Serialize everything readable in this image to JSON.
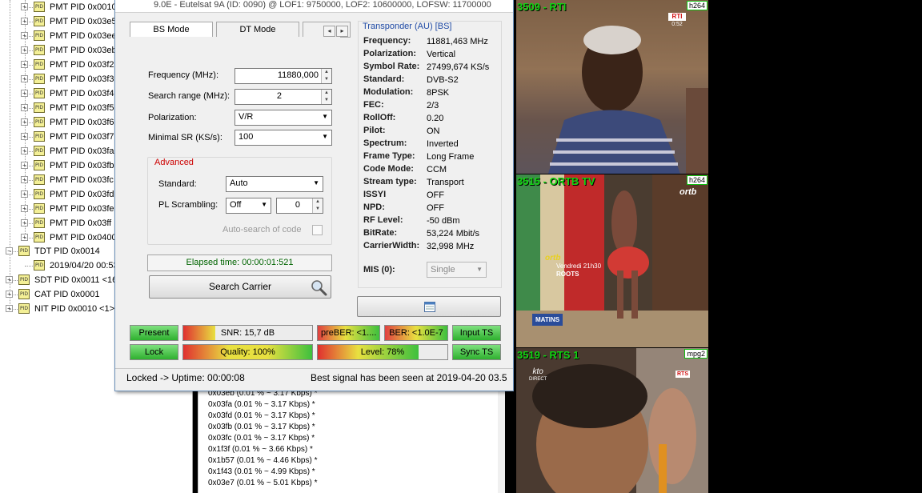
{
  "tree": {
    "pmt_items": [
      "PMT PID 0x0010",
      "PMT PID 0x03e5",
      "PMT PID 0x03ee",
      "PMT PID 0x03eb",
      "PMT PID 0x03f2",
      "PMT PID 0x03f3",
      "PMT PID 0x03f4",
      "PMT PID 0x03f5",
      "PMT PID 0x03f6",
      "PMT PID 0x03f7",
      "PMT PID 0x03fa",
      "PMT PID 0x03fb",
      "PMT PID 0x03fc",
      "PMT PID 0x03fd",
      "PMT PID 0x03fe",
      "PMT PID 0x03ff",
      "PMT PID 0x0400"
    ],
    "tdt": "TDT PID 0x0014",
    "tdt_child": "2019/04/20 00:53",
    "sdt": "SDT PID 0x0011 <16",
    "cat": "CAT PID 0x0001",
    "nit": "NIT PID 0x0010 <1>",
    "icon_tag": "PID"
  },
  "pid_list": [
    "0x03eb (0.01 % ~ 3.17 Kbps) *",
    "0x03fa (0.01 % ~ 3.17 Kbps) *",
    "0x03fd (0.01 % ~ 3.17 Kbps) *",
    "0x03fb (0.01 % ~ 3.17 Kbps) *",
    "0x03fc (0.01 % ~ 3.17 Kbps) *",
    "0x1f3f (0.01 % ~ 3.66 Kbps) *",
    "0x1b57 (0.01 % ~ 4.46 Kbps) *",
    "0x1f43 (0.01 % ~ 4.99 Kbps) *",
    "0x03e7 (0.01 % ~ 5.01 Kbps) *"
  ],
  "dialog": {
    "header": "9.0E - Eutelsat 9A (ID: 0090) @ LOF1: 9750000, LOF2: 10600000, LOFSW: 11700000",
    "tabs": [
      "BS Mode",
      "DT Mode",
      "S"
    ],
    "frequency_label": "Frequency (MHz):",
    "frequency_value": "11880,000",
    "search_range_label": "Search range (MHz):",
    "search_range_value": "2",
    "polarization_label": "Polarization:",
    "polarization_value": "V/R",
    "minimal_sr_label": "Minimal SR (KS/s):",
    "minimal_sr_value": "100",
    "advanced_title": "Advanced",
    "standard_label": "Standard:",
    "standard_value": "Auto",
    "pl_scrambling_label": "PL Scrambling:",
    "pl_scrambling_value": "Off",
    "pl_scrambling_num": "0",
    "auto_search_label": "Auto-search of code",
    "elapsed": "Elapsed time: 00:00:01:521",
    "search_button": "Search Carrier"
  },
  "transponder": {
    "title": "Transponder (AU) [BS]",
    "rows": [
      {
        "k": "Frequency:",
        "v": "11881,463 MHz"
      },
      {
        "k": "Polarization:",
        "v": "Vertical"
      },
      {
        "k": "Symbol Rate:",
        "v": "27499,674 KS/s"
      },
      {
        "k": "Standard:",
        "v": "DVB-S2"
      },
      {
        "k": "Modulation:",
        "v": "8PSK"
      },
      {
        "k": "FEC:",
        "v": "2/3"
      },
      {
        "k": "RollOff:",
        "v": "0.20"
      },
      {
        "k": "Pilot:",
        "v": "ON"
      },
      {
        "k": "Spectrum:",
        "v": "Inverted"
      },
      {
        "k": "Frame Type:",
        "v": "Long Frame"
      },
      {
        "k": "Code Mode:",
        "v": "CCM"
      },
      {
        "k": "Stream type:",
        "v": "Transport"
      },
      {
        "k": "ISSYI",
        "v": "OFF"
      },
      {
        "k": "NPD:",
        "v": "OFF"
      },
      {
        "k": "RF Level:",
        "v": "-50 dBm"
      },
      {
        "k": "BitRate:",
        "v": "53,224 Mbit/s"
      },
      {
        "k": "CarrierWidth:",
        "v": "32,998 MHz"
      }
    ],
    "mis_label": "MIS (0):",
    "mis_value": "Single"
  },
  "status": {
    "present": "Present",
    "lock": "Lock",
    "snr": "SNR: 15,7 dB",
    "snr_fill": 0.25,
    "quality": "Quality: 100%",
    "quality_fill": 1.0,
    "preber": "preBER: <1....",
    "ber": "BER: <1.0E-7",
    "level": "Level: 78%",
    "level_fill": 0.78,
    "input_ts": "Input TS",
    "sync_ts": "Sync TS"
  },
  "statusline": {
    "uptime": "Locked -> Uptime: 00:00:08",
    "best_signal": "Best signal has been seen at 2019-04-20 03.5"
  },
  "videos": [
    {
      "label": "3509 - RTI",
      "codec": "h264",
      "logo": "RTI",
      "logo_sub": "0:52"
    },
    {
      "label": "3515 - ORTB TV",
      "codec": "h264",
      "logo": "ortb",
      "caption_top": "ortb",
      "caption_day": "Vendredi 21h30",
      "caption_show": "ROOTS",
      "badge": "MATINS"
    },
    {
      "label": "3519 - RTS 1",
      "codec": "mpg2",
      "logo": "RTS",
      "logo_left": "kto",
      "logo_left_sub": "DIRECT"
    }
  ],
  "colors": {
    "channel_label": "#11d411",
    "accent_blue": "#1f4aa5",
    "advanced_red": "#cc0000",
    "elapsed_green": "#006400"
  }
}
